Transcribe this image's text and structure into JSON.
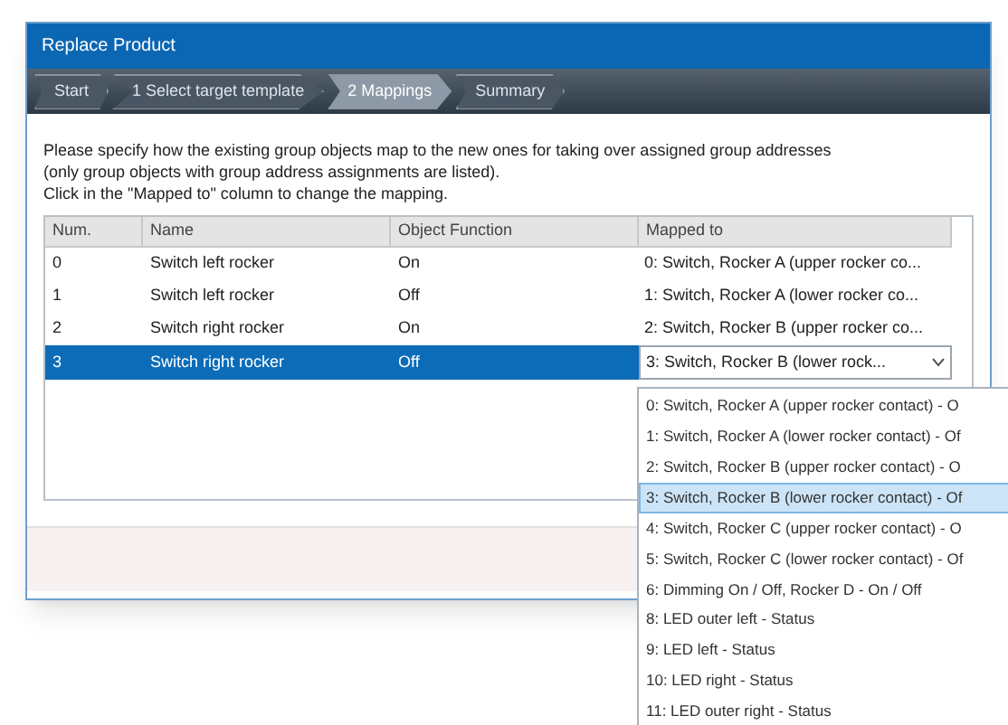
{
  "window": {
    "title": "Replace Product"
  },
  "steps": [
    {
      "label": "Start",
      "selected": false
    },
    {
      "label": "1 Select target template",
      "selected": false
    },
    {
      "label": "2 Mappings",
      "selected": true
    },
    {
      "label": "Summary",
      "selected": false
    }
  ],
  "instructions": [
    "Please specify how the existing group objects map to the new ones for taking over assigned group addresses",
    "(only group objects with group address assignments are listed).",
    "Click in the \"Mapped to\" column to change the mapping."
  ],
  "table": {
    "columns": [
      "Num.",
      "Name",
      "Object Function",
      "Mapped to"
    ],
    "rows": [
      {
        "num": "0",
        "name": "Switch left rocker",
        "function": "On",
        "mapped": "0: Switch, Rocker A  (upper rocker co...",
        "selected": false
      },
      {
        "num": "1",
        "name": "Switch left rocker",
        "function": "Off",
        "mapped": "1: Switch, Rocker A  (lower rocker co...",
        "selected": false
      },
      {
        "num": "2",
        "name": "Switch right rocker",
        "function": "On",
        "mapped": "2: Switch, Rocker B  (upper rocker co...",
        "selected": false
      },
      {
        "num": "3",
        "name": "Switch right rocker",
        "function": "Off",
        "mapped": "3: Switch, Rocker B  (lower rock...",
        "selected": true
      }
    ]
  },
  "dropdown": {
    "options": [
      {
        "label": "0: Switch, Rocker A  (upper rocker contact) - O",
        "selected": false
      },
      {
        "label": "1: Switch, Rocker A  (lower rocker contact) - Of",
        "selected": false
      },
      {
        "label": "2: Switch, Rocker B  (upper rocker contact) - O",
        "selected": false
      },
      {
        "label": "3: Switch, Rocker B  (lower rocker contact) - Of",
        "selected": true
      },
      {
        "label": "4: Switch, Rocker C  (upper rocker contact) - O",
        "selected": false
      },
      {
        "label": "5: Switch, Rocker C  (lower rocker contact) - Of",
        "selected": false
      },
      {
        "label": "6: Dimming On / Off, Rocker D - On / Off",
        "selected": false
      },
      {
        "label": "8: LED outer left - Status",
        "selected": false
      },
      {
        "label": "9: LED left - Status",
        "selected": false
      },
      {
        "label": "10: LED right - Status",
        "selected": false
      },
      {
        "label": "11: LED outer right - Status",
        "selected": false
      }
    ]
  }
}
